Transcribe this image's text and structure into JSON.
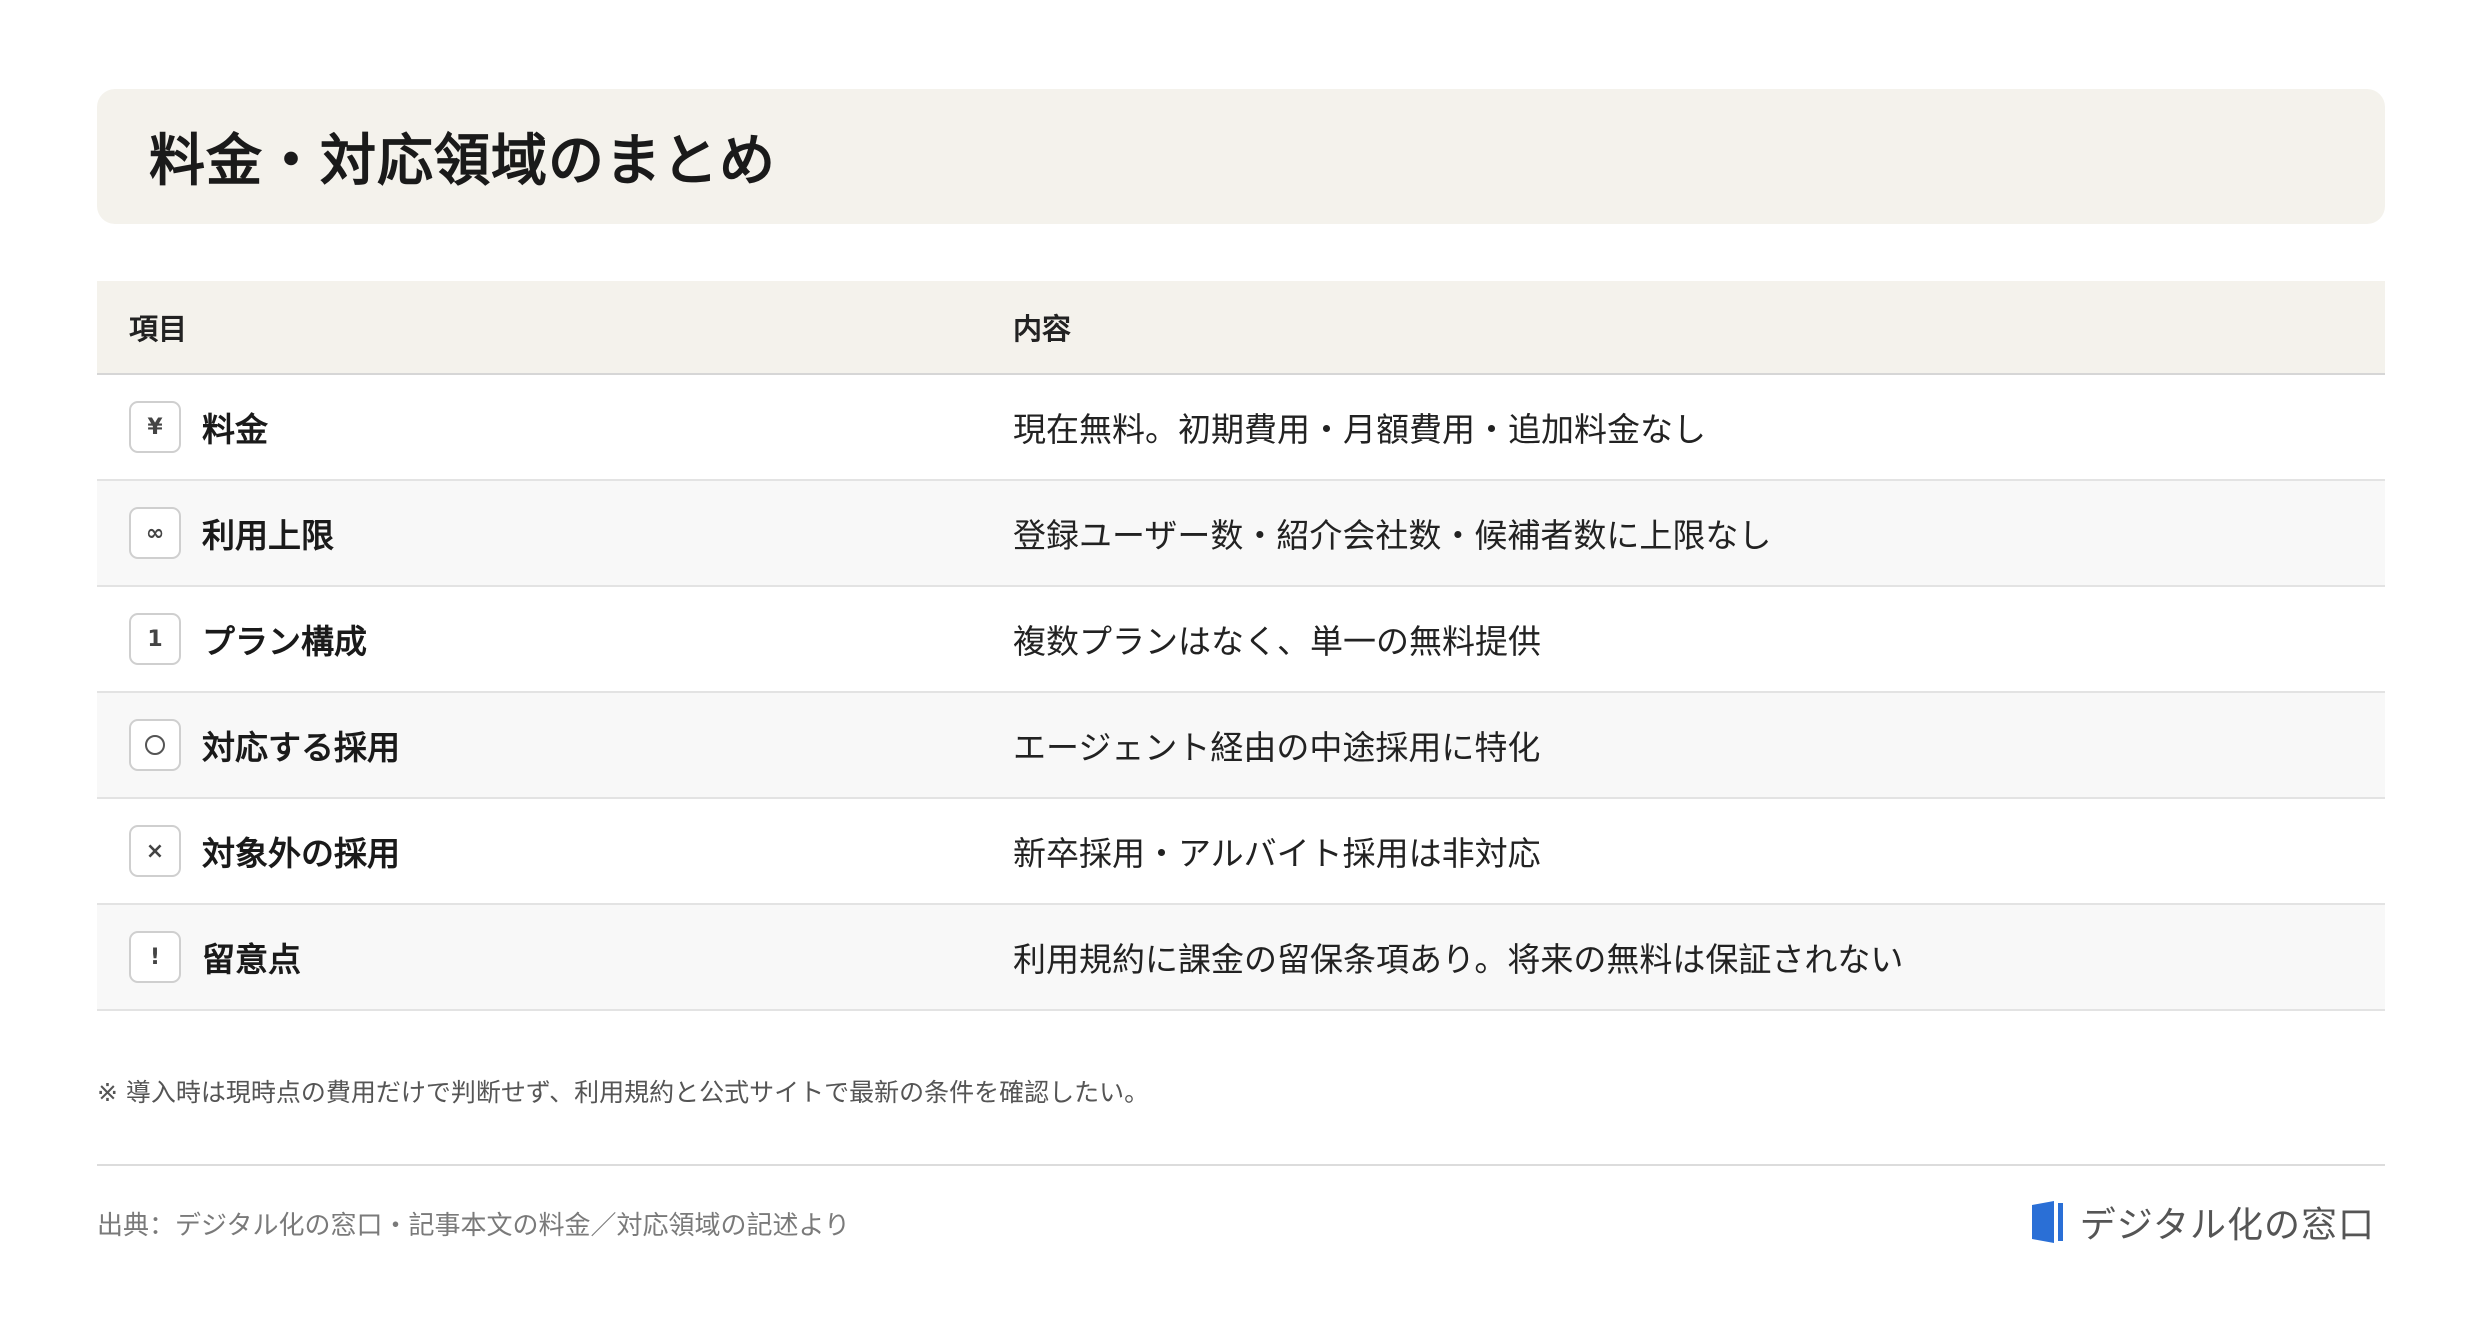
{
  "title": "料金・対応領域のまとめ",
  "table": {
    "headers": [
      "項目",
      "内容"
    ],
    "rows": [
      {
        "icon": "¥",
        "icon_name": "yen-icon",
        "label": "料金",
        "content": "現在無料。初期費用・月額費用・追加料金なし"
      },
      {
        "icon": "∞",
        "icon_name": "infinity-icon",
        "label": "利用上限",
        "content": "登録ユーザー数・紹介会社数・候補者数に上限なし"
      },
      {
        "icon": "1",
        "icon_name": "number-one-icon",
        "label": "プラン構成",
        "content": "複数プランはなく、単一の無料提供"
      },
      {
        "icon": "",
        "icon_name": "circle-icon",
        "label": "対応する採用",
        "content": "エージェント経由の中途採用に特化"
      },
      {
        "icon": "×",
        "icon_name": "cross-icon",
        "label": "対象外の採用",
        "content": "新卒採用・アルバイト採用は非対応"
      },
      {
        "icon": "!",
        "icon_name": "exclamation-icon",
        "label": "留意点",
        "content": "利用規約に課金の留保条項あり。将来の無料は保証されない"
      }
    ]
  },
  "note": "※ 導入時は現時点の費用だけで判断せず、利用規約と公式サイトで最新の条件を確認したい。",
  "source": "出典：デジタル化の窓口・記事本文の料金／対応領域の記述より",
  "logo": {
    "text": "デジタル化の窓口",
    "color": "#2a6fd6"
  }
}
